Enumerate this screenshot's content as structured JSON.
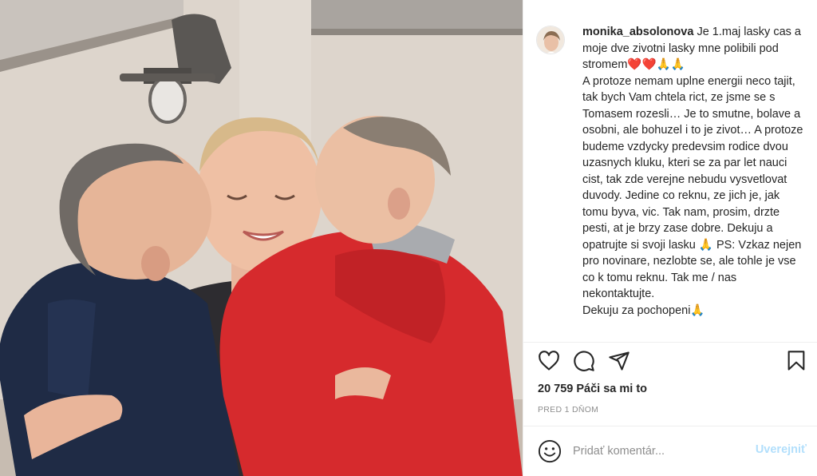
{
  "photo": {
    "alt_icon": "family-photo"
  },
  "post": {
    "username": "monika_absolonova",
    "caption": "Je 1.maj lasky cas a moje dve zivotni lasky mne polibili pod stromem❤️❤️🙏🙏\nA protoze nemam uplne energii neco tajit, tak bych Vam chtela rict, ze jsme se s Tomasem rozesli… Je to smutne, bolave a osobni, ale bohuzel i to je zivot… A protoze budeme vzdycky predevsim rodice dvou uzasnych kluku, kteri se za par let nauci cist, tak zde verejne nebudu vysvetlovat duvody. Jedine co reknu, ze jich je, jak tomu byva, vic. Tak nam, prosim, drzte pesti, at je brzy zase dobre. Dekuju a opatrujte si svoji lasku 🙏 PS: Vzkaz nejen pro novinare, nezlobte se, ale tohle je vse co k tomu reknu. Tak me / nas nekontaktujte.\nDekuju za pochopeni🙏",
    "likes": "20 759 Páči sa mi to",
    "timestamp": "PRED 1 DŇOM"
  },
  "actions": {
    "like_icon": "heart-icon",
    "comment_icon": "comment-icon",
    "share_icon": "share-icon",
    "save_icon": "bookmark-icon"
  },
  "comment": {
    "placeholder": "Pridať komentár...",
    "post_label": "Uverejniť",
    "post_color": "#b2dffc"
  }
}
